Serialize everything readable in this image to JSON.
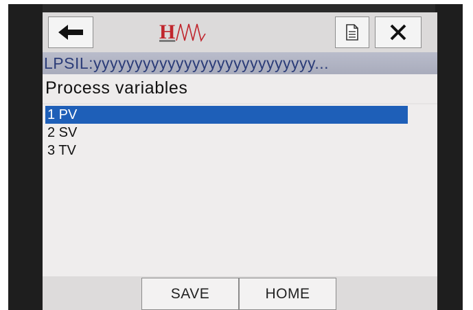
{
  "header": {
    "back_icon": "arrow-left-icon",
    "logo_text": "H",
    "doc_icon": "document-icon",
    "close_icon": "close-icon"
  },
  "tagline": "LPSIL:yyyyyyyyyyyyyyyyyyyyyyyyyyy...",
  "title": "Process variables",
  "menu": {
    "items": [
      {
        "label": "1 PV",
        "selected": true
      },
      {
        "label": "2 SV",
        "selected": false
      },
      {
        "label": "3 TV",
        "selected": false
      }
    ]
  },
  "footer": {
    "save_label": "SAVE",
    "home_label": "HOME"
  },
  "colors": {
    "selection": "#1e5fb8",
    "logo_red": "#c0262d",
    "tag_text": "#2b3c78"
  }
}
